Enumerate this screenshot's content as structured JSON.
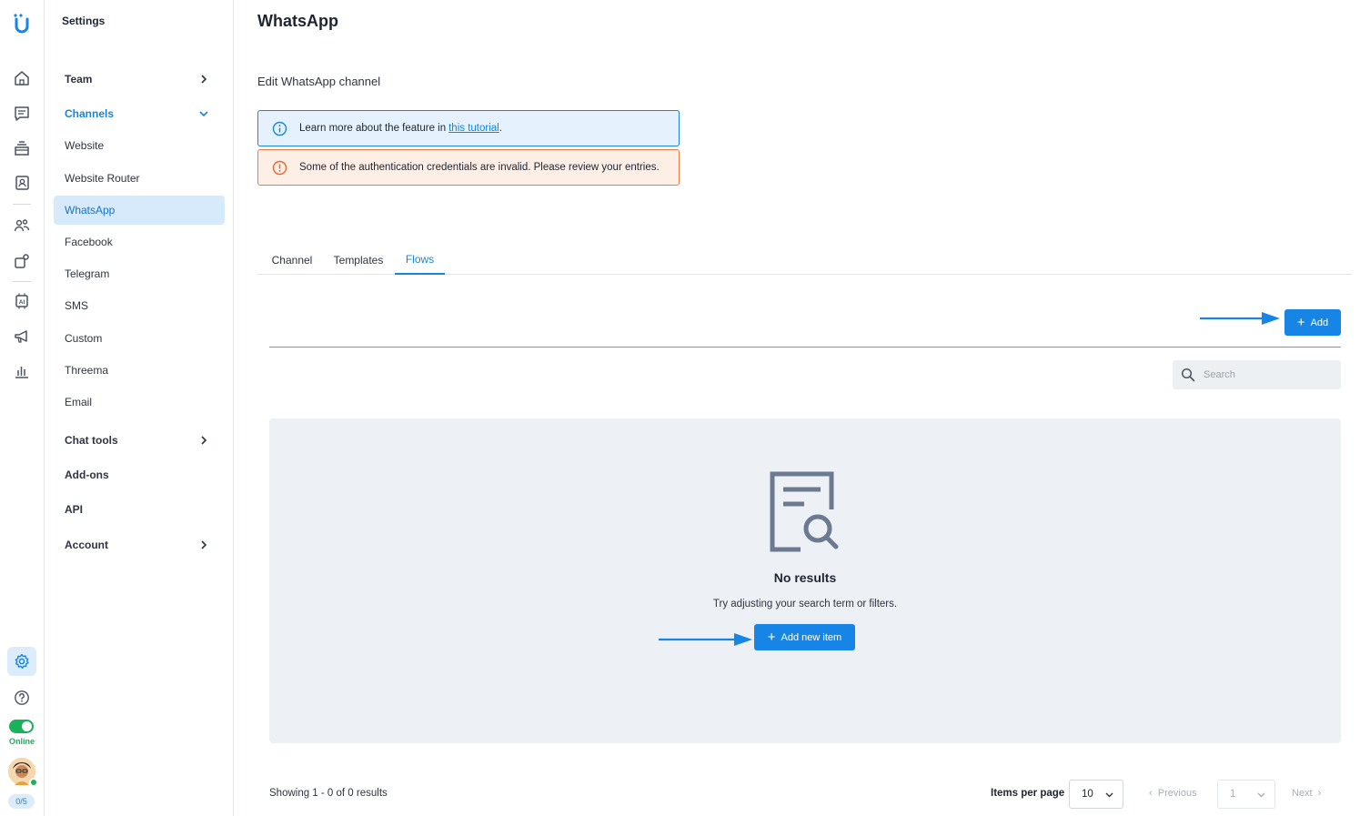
{
  "rail": {
    "logo": "u-logo-icon",
    "items": [
      "home-icon",
      "chat-icon",
      "inbox-stack-icon",
      "contacts-icon",
      "team-icon",
      "apps-icon",
      "ai-chip-icon",
      "megaphone-icon",
      "chart-icon"
    ],
    "settings": "gear-icon",
    "help": "help-icon",
    "status": "Online",
    "count": "0/5"
  },
  "sidebar": {
    "title": "Settings",
    "items": [
      {
        "label": "Team"
      },
      {
        "label": "Channels"
      },
      {
        "label": "Website"
      },
      {
        "label": "Website Router"
      },
      {
        "label": "WhatsApp"
      },
      {
        "label": "Facebook"
      },
      {
        "label": "Telegram"
      },
      {
        "label": "SMS"
      },
      {
        "label": "Custom"
      },
      {
        "label": "Threema"
      },
      {
        "label": "Email"
      },
      {
        "label": "Chat tools"
      },
      {
        "label": "Add-ons"
      },
      {
        "label": "API"
      },
      {
        "label": "Account"
      }
    ]
  },
  "page": {
    "title": "WhatsApp",
    "subtitle": "Edit WhatsApp channel",
    "info_text": "Learn more about the feature in",
    "info_link": "this tutorial",
    "info_end": ".",
    "error_text": "Some of the authentication credentials are invalid. Please review your entries."
  },
  "tabs": [
    {
      "label": "Channel"
    },
    {
      "label": "Templates"
    },
    {
      "label": "Flows"
    }
  ],
  "toolbar": {
    "add_label": "Add",
    "search_placeholder": "Search"
  },
  "empty": {
    "title": "No results",
    "text": "Try adjusting your search term or filters.",
    "add_label": "Add new item"
  },
  "footer": {
    "showing": "Showing 1 - 0 of 0 results",
    "items_per_page_label": "Items per page",
    "items_per_page_value": "10",
    "previous": "Previous",
    "page_value": "1",
    "next": "Next"
  },
  "colors": {
    "accent": "#1685e6",
    "info_border": "#1d86d8",
    "error_border": "#ea7a48",
    "online": "#19b15a"
  }
}
